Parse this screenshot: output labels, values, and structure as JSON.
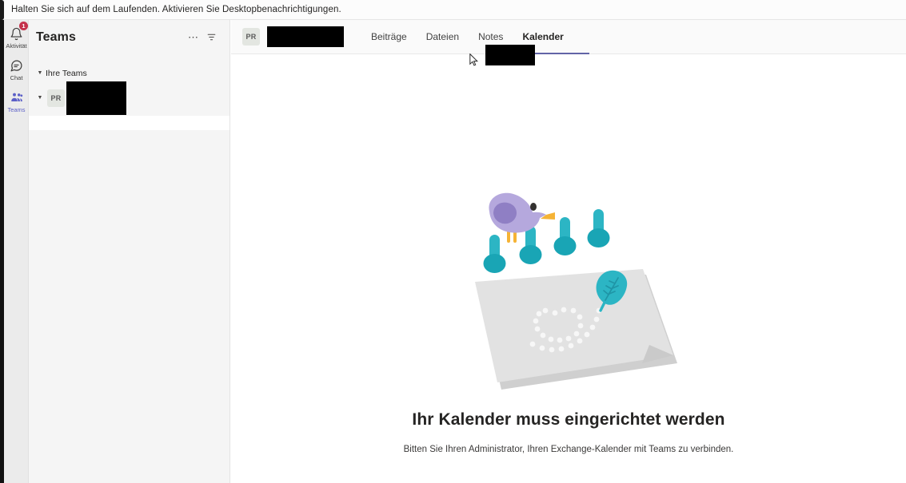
{
  "notification": {
    "text": "Halten Sie sich auf dem Laufenden. Aktivieren Sie Desktopbenachrichtigungen."
  },
  "rail": {
    "items": [
      {
        "label": "Aktivität",
        "icon": "bell-icon",
        "badge": "1",
        "active": false
      },
      {
        "label": "Chat",
        "icon": "chat-icon",
        "badge": "",
        "active": false
      },
      {
        "label": "Teams",
        "icon": "teams-icon",
        "badge": "",
        "active": true
      }
    ]
  },
  "teams_panel": {
    "title": "Teams",
    "more_options_icon": "ellipsis-icon",
    "filter_icon": "filter-icon",
    "section": {
      "label": "Ihre Teams",
      "collapse_icon": "chevron-down-icon"
    },
    "team": {
      "avatar_initials": "PR",
      "name": "",
      "collapse_icon": "chevron-down-icon"
    },
    "channel": {
      "name": ""
    }
  },
  "main": {
    "team_avatar_initials": "PR",
    "team_name": "",
    "tabs": [
      {
        "label": "Beiträge",
        "active": false
      },
      {
        "label": "Dateien",
        "active": false
      },
      {
        "label": "Notes",
        "active": false
      },
      {
        "label": "Kalender",
        "active": true
      }
    ],
    "empty_state": {
      "title": "Ihr Kalender muss eingerichtet werden",
      "subtitle": "Bitten Sie Ihren Administrator, Ihren Exchange-Kalender mit Teams zu verbinden.",
      "illustration": "calendar-bird-illustration"
    }
  },
  "colors": {
    "accent_purple": "#6264a7",
    "rail_active": "#5b5fc7",
    "badge_red": "#c4314b",
    "teal": "#2cb5c4",
    "bird_purple": "#b5a8dd"
  }
}
